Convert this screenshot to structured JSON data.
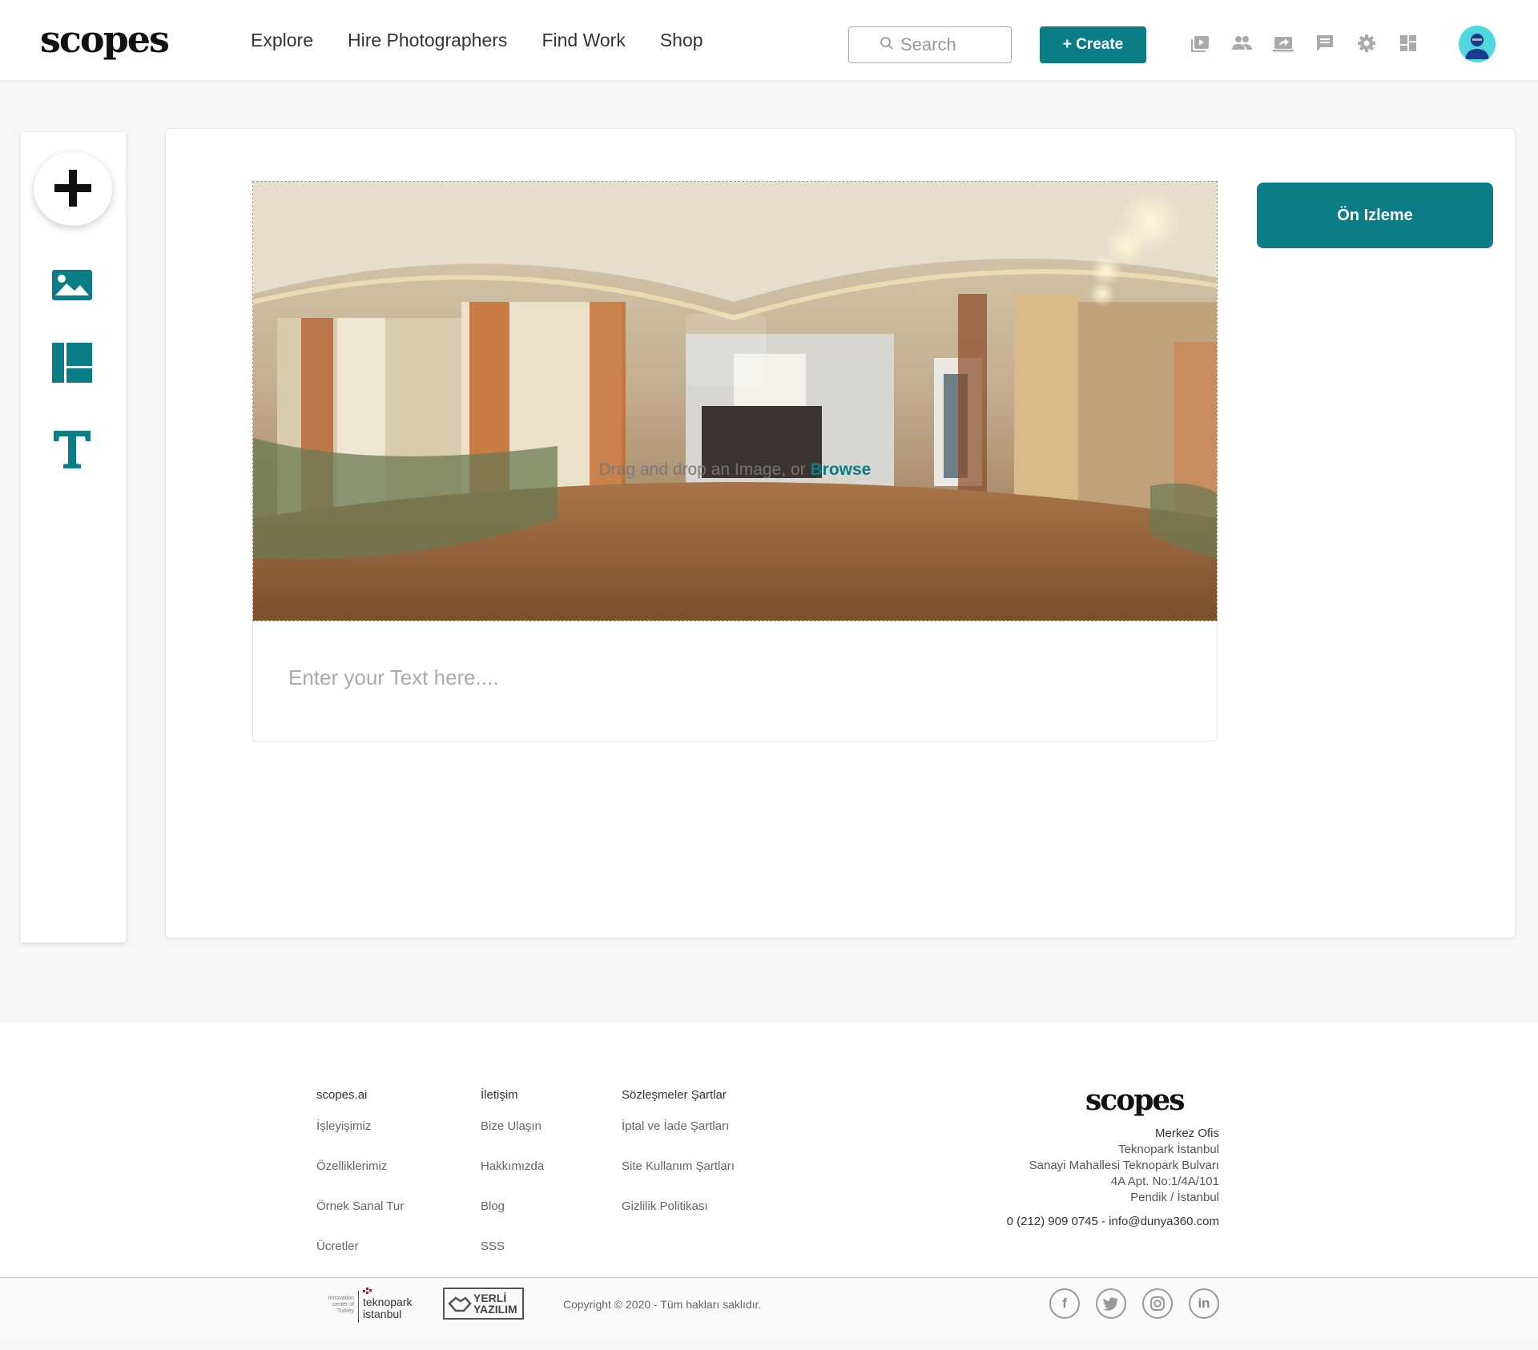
{
  "header": {
    "logo": "scopes",
    "nav": [
      "Explore",
      "Hire Photographers",
      "Find Work",
      "Shop"
    ],
    "search_placeholder": "Search",
    "create_label": "+ Create",
    "icons": [
      "video-library-icon",
      "people-icon",
      "share-screen-icon",
      "chat-icon",
      "gear-icon",
      "dashboard-icon"
    ]
  },
  "tools": [
    "add-icon",
    "image-icon",
    "layout-icon",
    "text-icon"
  ],
  "editor": {
    "drop_text": "Drag and drop an Image, or",
    "browse_label": "Browse",
    "text_placeholder": "Enter your Text here....",
    "preview_label": "Ön Izleme"
  },
  "footer": {
    "col1": {
      "title": "scopes.ai",
      "links": [
        "İşleyişimiz",
        "Özelliklerimiz",
        "Örnek Sanal Tur",
        "Ücretler"
      ]
    },
    "col2": {
      "title": "İletişim",
      "links": [
        "Bize Ulaşın",
        "Hakkımızda",
        "Blog",
        "SSS"
      ]
    },
    "col3": {
      "title": "Sözleşmeler Şartlar",
      "links": [
        "İptal ve İade Şartları",
        "Site Kullanım Şartları",
        "Gizlilik Politikası"
      ]
    },
    "logo": "scopes",
    "office_title": "Merkez Ofis",
    "address": [
      "Teknopark İstanbul",
      "Sanayi Mahallesi Teknopark Bulvarı",
      "4A Apt. No:1/4A/101",
      "Pendik / İstanbul"
    ],
    "contact": "0 (212) 909 0745 - info@dunya360.com",
    "partner1_small": [
      "Innovation",
      "center of",
      "Turkey"
    ],
    "partner1_name": [
      "teknopark",
      "istanbul"
    ],
    "partner2_name": [
      "YERLİ",
      "YAZILIM"
    ],
    "copyright": "Copyright © 2020 - Tüm hakları saklıdır.",
    "social": [
      "facebook-icon",
      "twitter-icon",
      "instagram-icon",
      "linkedin-icon"
    ]
  },
  "colors": {
    "accent": "#0a7d86",
    "text": "#333333",
    "muted": "#999999"
  }
}
